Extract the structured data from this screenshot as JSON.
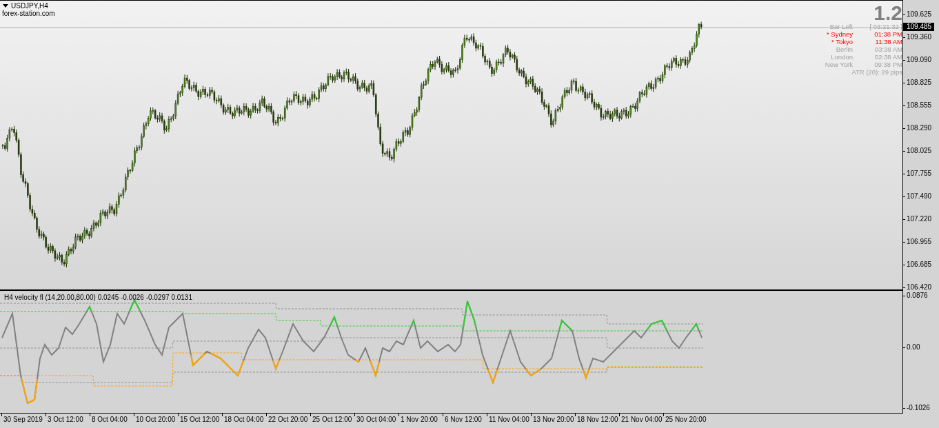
{
  "chart": {
    "symbol": "USDJPY,H4",
    "site": "forex-station.com",
    "big_value": "1.2",
    "current_price": "109.485"
  },
  "info": [
    {
      "label": "Bar Left",
      "value": "[ 03:21:32 ]",
      "open": false
    },
    {
      "label": "* Sydney",
      "value": "01:38 PM",
      "open": true
    },
    {
      "label": "* Tokyo",
      "value": "11:38 AM",
      "open": true
    },
    {
      "label": "Berlin",
      "value": "03:38 AM",
      "open": false
    },
    {
      "label": "London",
      "value": "02:38 AM",
      "open": false
    },
    {
      "label": "New York",
      "value": "09:38 PM",
      "open": false
    }
  ],
  "atr": "ATR (20): 29 pips",
  "price_axis": [
    "109.625",
    "109.360",
    "109.090",
    "108.825",
    "108.555",
    "108.290",
    "108.025",
    "107.755",
    "107.490",
    "107.220",
    "106.955",
    "106.685",
    "106.420"
  ],
  "indicator": {
    "label": "H4 velocity fl (14,20.00,80.00) 0.0245 -0.0026 -0.0297 0.0131",
    "axis": [
      "0.0876",
      "0.00",
      "-0.1026"
    ]
  },
  "time_axis": [
    "30 Sep 2019",
    "3 Oct 12:00",
    "8 Oct 04:00",
    "10 Oct 20:00",
    "15 Oct 12:00",
    "18 Oct 04:00",
    "22 Oct 20:00",
    "25 Oct 12:00",
    "30 Oct 04:00",
    "1 Nov 20:00",
    "6 Nov 12:00",
    "11 Nov 04:00",
    "13 Nov 20:00",
    "18 Nov 12:00",
    "21 Nov 04:00",
    "25 Nov 20:00"
  ]
}
